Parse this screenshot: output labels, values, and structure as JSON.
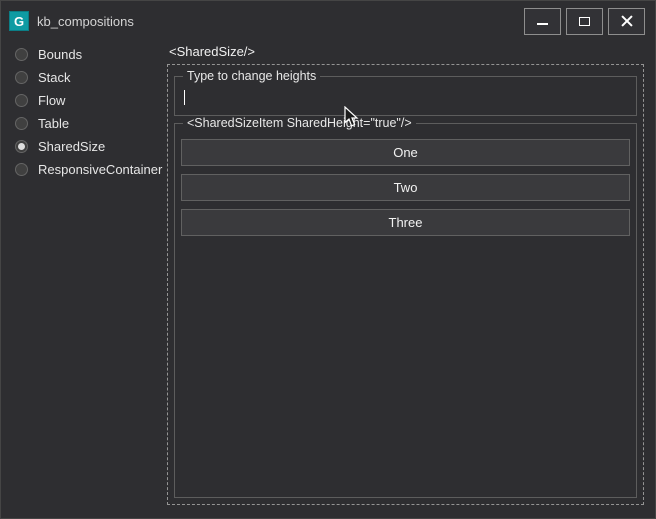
{
  "window": {
    "title": "kb_compositions",
    "icon_letter": "G",
    "controls": [
      {
        "name": "minimize"
      },
      {
        "name": "maximize"
      },
      {
        "name": "close"
      }
    ]
  },
  "sidebar": {
    "items": [
      {
        "label": "Bounds",
        "selected": false
      },
      {
        "label": "Stack",
        "selected": false
      },
      {
        "label": "Flow",
        "selected": false
      },
      {
        "label": "Table",
        "selected": false
      },
      {
        "label": "SharedSize",
        "selected": true
      },
      {
        "label": "ResponsiveContainer",
        "selected": false
      }
    ]
  },
  "main": {
    "header": "<SharedSize/>",
    "type_group": {
      "label": "Type to change heights",
      "input_value": ""
    },
    "shared_group": {
      "label": "<SharedSizeItem SharedHeight=\"true\"/>",
      "buttons": [
        "One",
        "Two",
        "Three"
      ]
    }
  },
  "colors": {
    "accent_teal": "#0f9ba3",
    "window_bg": "#2e2e31",
    "button_face": "#3a3a3d",
    "border": "#5d5d5d",
    "dashed_border": "#949494"
  }
}
